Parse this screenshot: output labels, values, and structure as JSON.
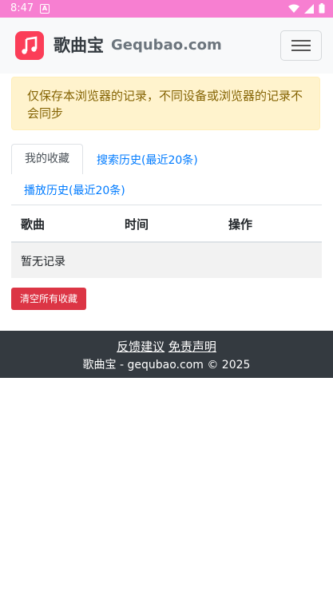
{
  "status_bar": {
    "time": "8:47",
    "notification_glyph": "A"
  },
  "navbar": {
    "brand_cn": "歌曲宝",
    "brand_en": "Gequbao.com",
    "logo_icon": "music-note-icon",
    "menu_icon": "hamburger-icon"
  },
  "alert": {
    "text": "仅保存本浏览器的记录，不同设备或浏览器的记录不会同步"
  },
  "tabs": [
    {
      "label": "我的收藏"
    },
    {
      "label": "搜索历史(最近20条)"
    },
    {
      "label": "播放历史(最近20条)"
    }
  ],
  "table": {
    "headers": [
      "歌曲",
      "时间",
      "操作"
    ],
    "empty_text": "暂无记录"
  },
  "clear_button": "清空所有收藏",
  "footer": {
    "feedback": "反馈建议",
    "disclaimer": "免责声明",
    "copyright": "歌曲宝 - gequbao.com © 2025"
  },
  "colors": {
    "status_bar": "#f77fd1",
    "logo": "#fb3e58",
    "link": "#007bff",
    "danger": "#dc3545",
    "footer": "#343a40",
    "alert_bg": "#fff3cd"
  }
}
